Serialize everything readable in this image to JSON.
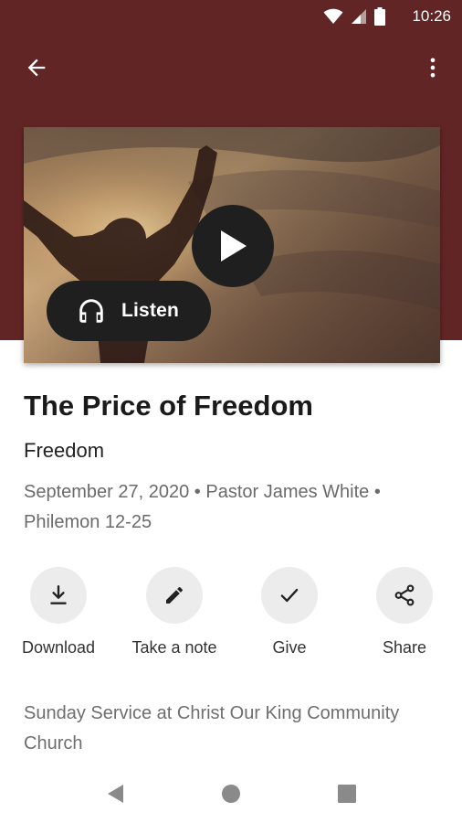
{
  "status_bar": {
    "time": "10:26",
    "icons": [
      "wifi-icon",
      "signal-icon",
      "battery-icon"
    ]
  },
  "app_bar": {
    "back_icon": "arrow-back-icon",
    "menu_icon": "more-vert-icon"
  },
  "colors": {
    "header_background": "#622525",
    "button_dark": "#1f1f1f",
    "action_circle": "#ececec"
  },
  "hero": {
    "image_alt": "Silhouette of a person raising arms toward a cloudy sunset sky",
    "play_icon": "play-icon",
    "listen_label": "Listen",
    "listen_icon": "headphones-icon"
  },
  "sermon": {
    "title": "The Price of Freedom",
    "series": "Freedom",
    "meta": "September 27, 2020 • Pastor James White • Philemon 12-25"
  },
  "actions": [
    {
      "label": "Download",
      "icon": "download-icon"
    },
    {
      "label": "Take a note",
      "icon": "pencil-icon"
    },
    {
      "label": "Give",
      "icon": "check-icon"
    },
    {
      "label": "Share",
      "icon": "share-icon"
    }
  ],
  "description": "Sunday Service at Christ Our King Community Church",
  "nav_bar": {
    "icons": [
      "nav-back-icon",
      "nav-home-icon",
      "nav-recents-icon"
    ]
  }
}
